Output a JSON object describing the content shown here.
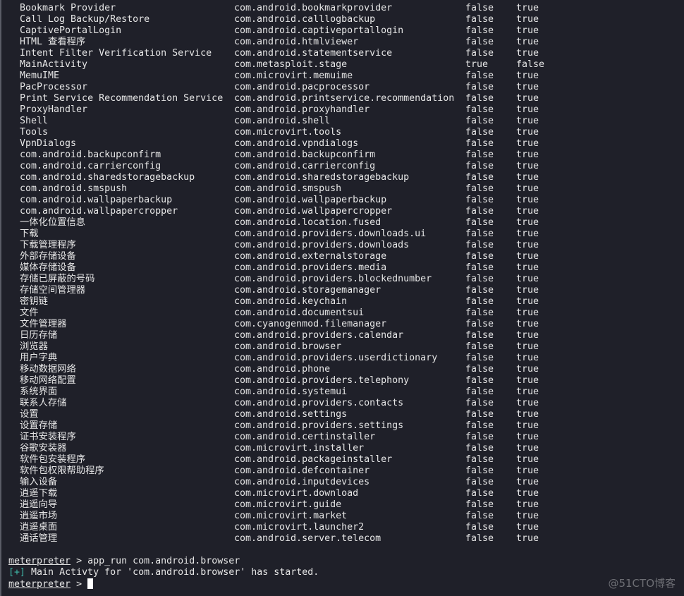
{
  "apps": [
    [
      "Bookmark Provider",
      "com.android.bookmarkprovider",
      "false",
      "true"
    ],
    [
      "Call Log Backup/Restore",
      "com.android.calllogbackup",
      "false",
      "true"
    ],
    [
      "CaptivePortalLogin",
      "com.android.captiveportallogin",
      "false",
      "true"
    ],
    [
      "HTML 查看程序",
      "com.android.htmlviewer",
      "false",
      "true"
    ],
    [
      "Intent Filter Verification Service",
      "com.android.statementservice",
      "false",
      "true"
    ],
    [
      "MainActivity",
      "com.metasploit.stage",
      "true",
      "false"
    ],
    [
      "MemuIME",
      "com.microvirt.memuime",
      "false",
      "true"
    ],
    [
      "PacProcessor",
      "com.android.pacprocessor",
      "false",
      "true"
    ],
    [
      "Print Service Recommendation Service",
      "com.android.printservice.recommendation",
      "false",
      "true"
    ],
    [
      "ProxyHandler",
      "com.android.proxyhandler",
      "false",
      "true"
    ],
    [
      "Shell",
      "com.android.shell",
      "false",
      "true"
    ],
    [
      "Tools",
      "com.microvirt.tools",
      "false",
      "true"
    ],
    [
      "VpnDialogs",
      "com.android.vpndialogs",
      "false",
      "true"
    ],
    [
      "com.android.backupconfirm",
      "com.android.backupconfirm",
      "false",
      "true"
    ],
    [
      "com.android.carrierconfig",
      "com.android.carrierconfig",
      "false",
      "true"
    ],
    [
      "com.android.sharedstoragebackup",
      "com.android.sharedstoragebackup",
      "false",
      "true"
    ],
    [
      "com.android.smspush",
      "com.android.smspush",
      "false",
      "true"
    ],
    [
      "com.android.wallpaperbackup",
      "com.android.wallpaperbackup",
      "false",
      "true"
    ],
    [
      "com.android.wallpapercropper",
      "com.android.wallpapercropper",
      "false",
      "true"
    ],
    [
      "一体化位置信息",
      "com.android.location.fused",
      "false",
      "true"
    ],
    [
      "下载",
      "com.android.providers.downloads.ui",
      "false",
      "true"
    ],
    [
      "下载管理程序",
      "com.android.providers.downloads",
      "false",
      "true"
    ],
    [
      "外部存储设备",
      "com.android.externalstorage",
      "false",
      "true"
    ],
    [
      "媒体存储设备",
      "com.android.providers.media",
      "false",
      "true"
    ],
    [
      "存储已屏蔽的号码",
      "com.android.providers.blockednumber",
      "false",
      "true"
    ],
    [
      "存储空间管理器",
      "com.android.storagemanager",
      "false",
      "true"
    ],
    [
      "密钥链",
      "com.android.keychain",
      "false",
      "true"
    ],
    [
      "文件",
      "com.android.documentsui",
      "false",
      "true"
    ],
    [
      "文件管理器",
      "com.cyanogenmod.filemanager",
      "false",
      "true"
    ],
    [
      "日历存储",
      "com.android.providers.calendar",
      "false",
      "true"
    ],
    [
      "浏览器",
      "com.android.browser",
      "false",
      "true"
    ],
    [
      "用户字典",
      "com.android.providers.userdictionary",
      "false",
      "true"
    ],
    [
      "移动数据网络",
      "com.android.phone",
      "false",
      "true"
    ],
    [
      "移动网络配置",
      "com.android.providers.telephony",
      "false",
      "true"
    ],
    [
      "系统界面",
      "com.android.systemui",
      "false",
      "true"
    ],
    [
      "联系人存储",
      "com.android.providers.contacts",
      "false",
      "true"
    ],
    [
      "设置",
      "com.android.settings",
      "false",
      "true"
    ],
    [
      "设置存储",
      "com.android.providers.settings",
      "false",
      "true"
    ],
    [
      "证书安装程序",
      "com.android.certinstaller",
      "false",
      "true"
    ],
    [
      "谷歌安装器",
      "com.microvirt.installer",
      "false",
      "true"
    ],
    [
      "软件包安装程序",
      "com.android.packageinstaller",
      "false",
      "true"
    ],
    [
      "软件包权限帮助程序",
      "com.android.defcontainer",
      "false",
      "true"
    ],
    [
      "输入设备",
      "com.android.inputdevices",
      "false",
      "true"
    ],
    [
      "逍遥下载",
      "com.microvirt.download",
      "false",
      "true"
    ],
    [
      "逍遥向导",
      "com.microvirt.guide",
      "false",
      "true"
    ],
    [
      "逍遥市场",
      "com.microvirt.market",
      "false",
      "true"
    ],
    [
      "逍遥桌面",
      "com.microvirt.launcher2",
      "false",
      "true"
    ],
    [
      "通话管理",
      "com.android.server.telecom",
      "false",
      "true"
    ]
  ],
  "console": {
    "prompt": "meterpreter",
    "sep": " > ",
    "command": "app_run com.android.browser",
    "status_tag": "[+]",
    "status_text": " Main Activty for 'com.android.browser' has started."
  },
  "watermark": "@51CTO博客"
}
